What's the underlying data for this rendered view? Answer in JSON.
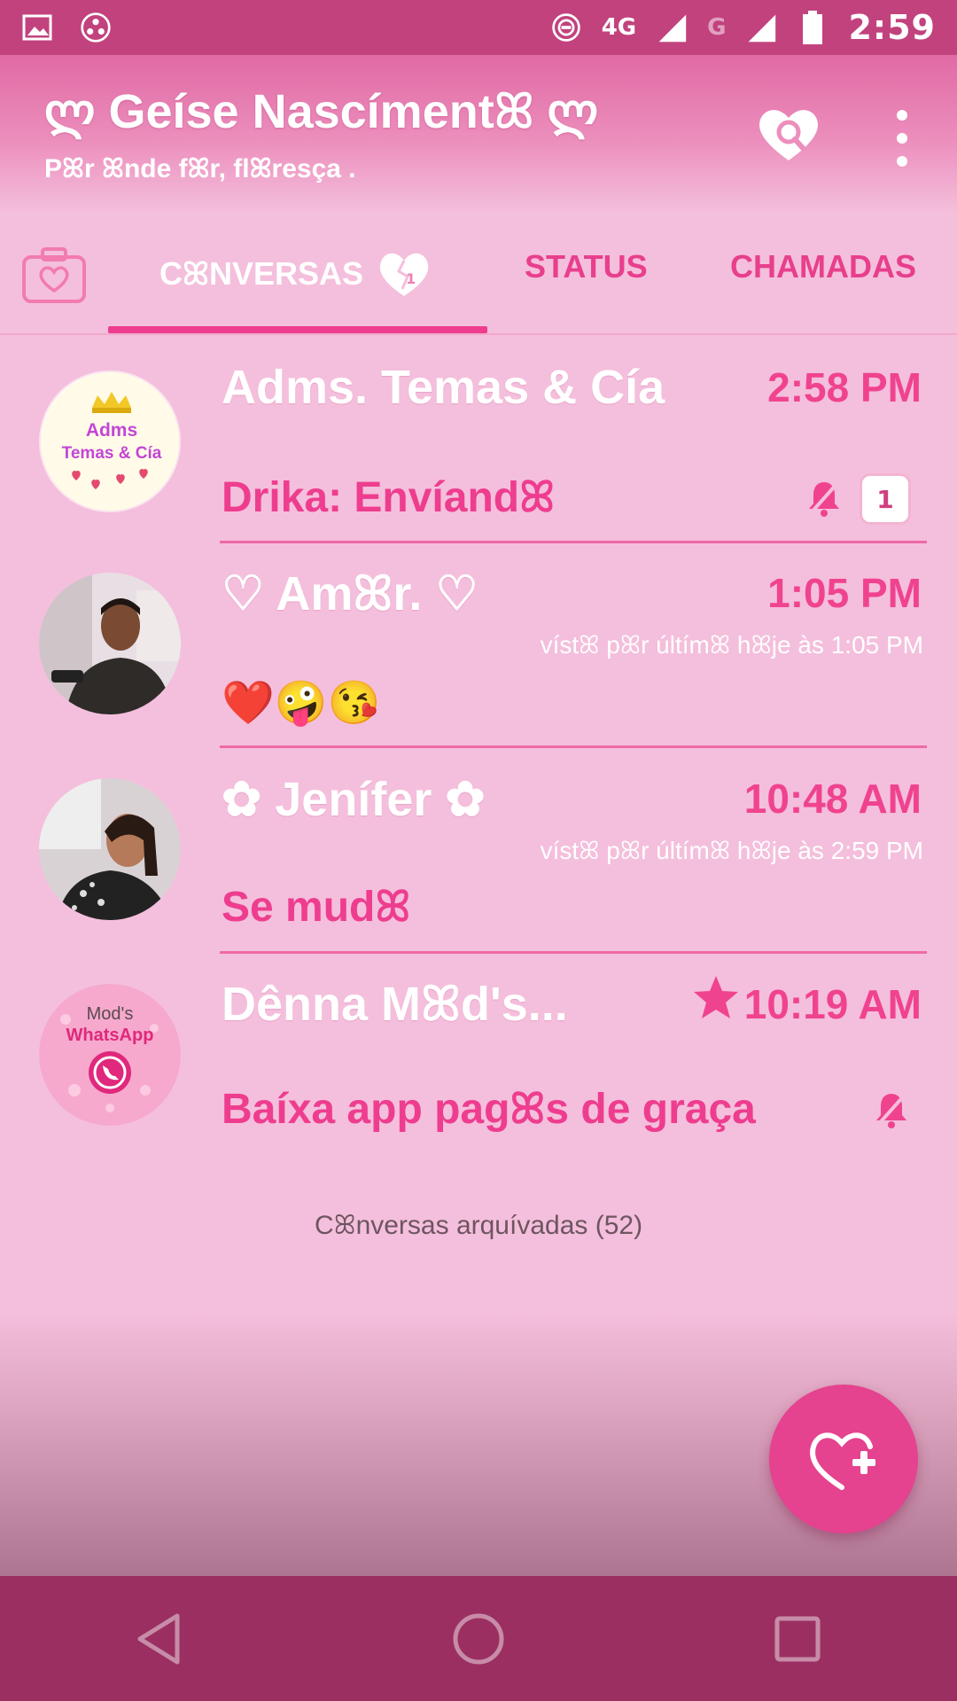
{
  "status_bar": {
    "network_label": "4G",
    "network2_label": "G",
    "time": "2:59"
  },
  "header": {
    "title": "ლ Geíse Nascímentꕤ ლ",
    "subtitle": "Pꕤr ꕤnde fꕤr, flꕤresça ."
  },
  "tabs": {
    "conversas": "CꕤNVERSAS",
    "status": "STATUS",
    "chamadas": "CHAMADAS"
  },
  "chats": [
    {
      "name": "Adms. Temas & Cía",
      "time": "2:58 PM",
      "message": "Drika: Envíandꕤ",
      "badge": "1",
      "avatar_text_1": "Adms",
      "avatar_text_2": "Temas & Cía"
    },
    {
      "name": "♡ Amꕤr. ♡",
      "time": "1:05 PM",
      "seen": "vístꕤ pꕤr últímꕤ hꕤje às 1:05 PM",
      "message": "❤️🤪😘"
    },
    {
      "name": "✿ Jenífer ✿",
      "time": "10:48 AM",
      "seen": "vístꕤ pꕤr últímꕤ hꕤje às 2:59 PM",
      "message": "Se mudꕤ"
    },
    {
      "name": "Dênna Mꕤd's...",
      "time": "10:19 AM",
      "message": "Baíxa app pagꕤs de graça",
      "avatar_text_1": "Mod's",
      "avatar_text_2": "WhatsApp"
    }
  ],
  "archived": "Cꕤnversas arquívadas (52)",
  "colors": {
    "accent": "#ee3d8f",
    "background": "#f4bfdc",
    "status_bar": "#c2427e",
    "nav_bar": "#9b2f62",
    "fab": "#e5428f"
  },
  "icons": {
    "heart_search": "heart-search-icon",
    "more": "more-vert-icon",
    "camera": "camera-icon",
    "broken_heart": "broken-heart-icon",
    "mute": "mute-icon",
    "star": "star-icon",
    "fab": "heart-plus-icon",
    "back": "back-icon",
    "home": "home-icon",
    "recents": "recents-icon"
  }
}
